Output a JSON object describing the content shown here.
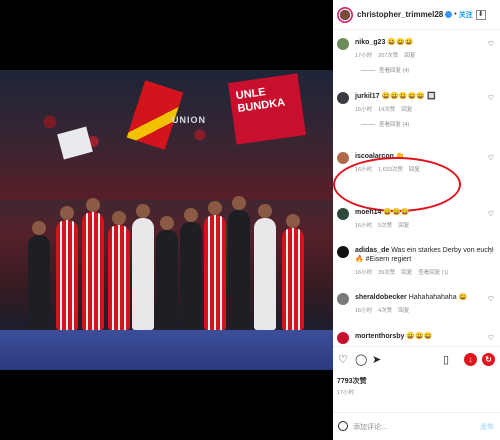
{
  "post": {
    "username": "christopher_trimmel28",
    "follow_label": "关注",
    "download_icon": "download-icon"
  },
  "photo": {
    "banner_text": "UNLE BUNDKA",
    "stadium_sign": "UNION"
  },
  "comments": [
    {
      "user": "niko_g23",
      "text": "😀😀😀",
      "time": "17小时",
      "likes": "207次赞",
      "reply": "回复",
      "view_replies": "查看回复 (4)",
      "avatar_color": "#6b8e5a"
    },
    {
      "user": "jurkil17",
      "text": "😀😀😀😀😀 🔲",
      "time": "16小时",
      "likes": "14次赞",
      "reply": "回复",
      "view_replies": "查看回复 (4)",
      "avatar_color": "#3b3b44"
    },
    {
      "user": "iscoalarcon",
      "text": "👏",
      "time": "16小时",
      "likes": "1,633次赞",
      "reply": "回复",
      "avatar_color": "#b06a4a"
    },
    {
      "user": "moeh14",
      "text": "😀😀😀",
      "time": "16小时",
      "likes": "5次赞",
      "reply": "回复",
      "avatar_color": "#2e4a3a"
    },
    {
      "user": "adidas_de",
      "text": "Was ein starkes Derby von euch! 🔥 #Eisern regiert",
      "time": "16小时",
      "likes": "39次赞",
      "reply": "回复",
      "view_replies": "查看回复 (1)",
      "avatar_color": "#111111"
    },
    {
      "user": "sheraldobecker",
      "text": "Hahahahahaha 😀",
      "time": "16小时",
      "likes": "4次赞",
      "reply": "回复",
      "avatar_color": "#7a7a7a"
    },
    {
      "user": "mortenthorsby",
      "text": "😀😀😀",
      "time": "",
      "likes": "",
      "reply": "",
      "avatar_color": "#c8102e"
    }
  ],
  "footer": {
    "likes": "7793次赞",
    "time_ago": "17小时",
    "add_comment_placeholder": "添加评论...",
    "post_label": "发布"
  },
  "colors": {
    "brand_blue": "#0095f6",
    "highlight_red": "#e0141d",
    "union_red": "#c8102e"
  }
}
